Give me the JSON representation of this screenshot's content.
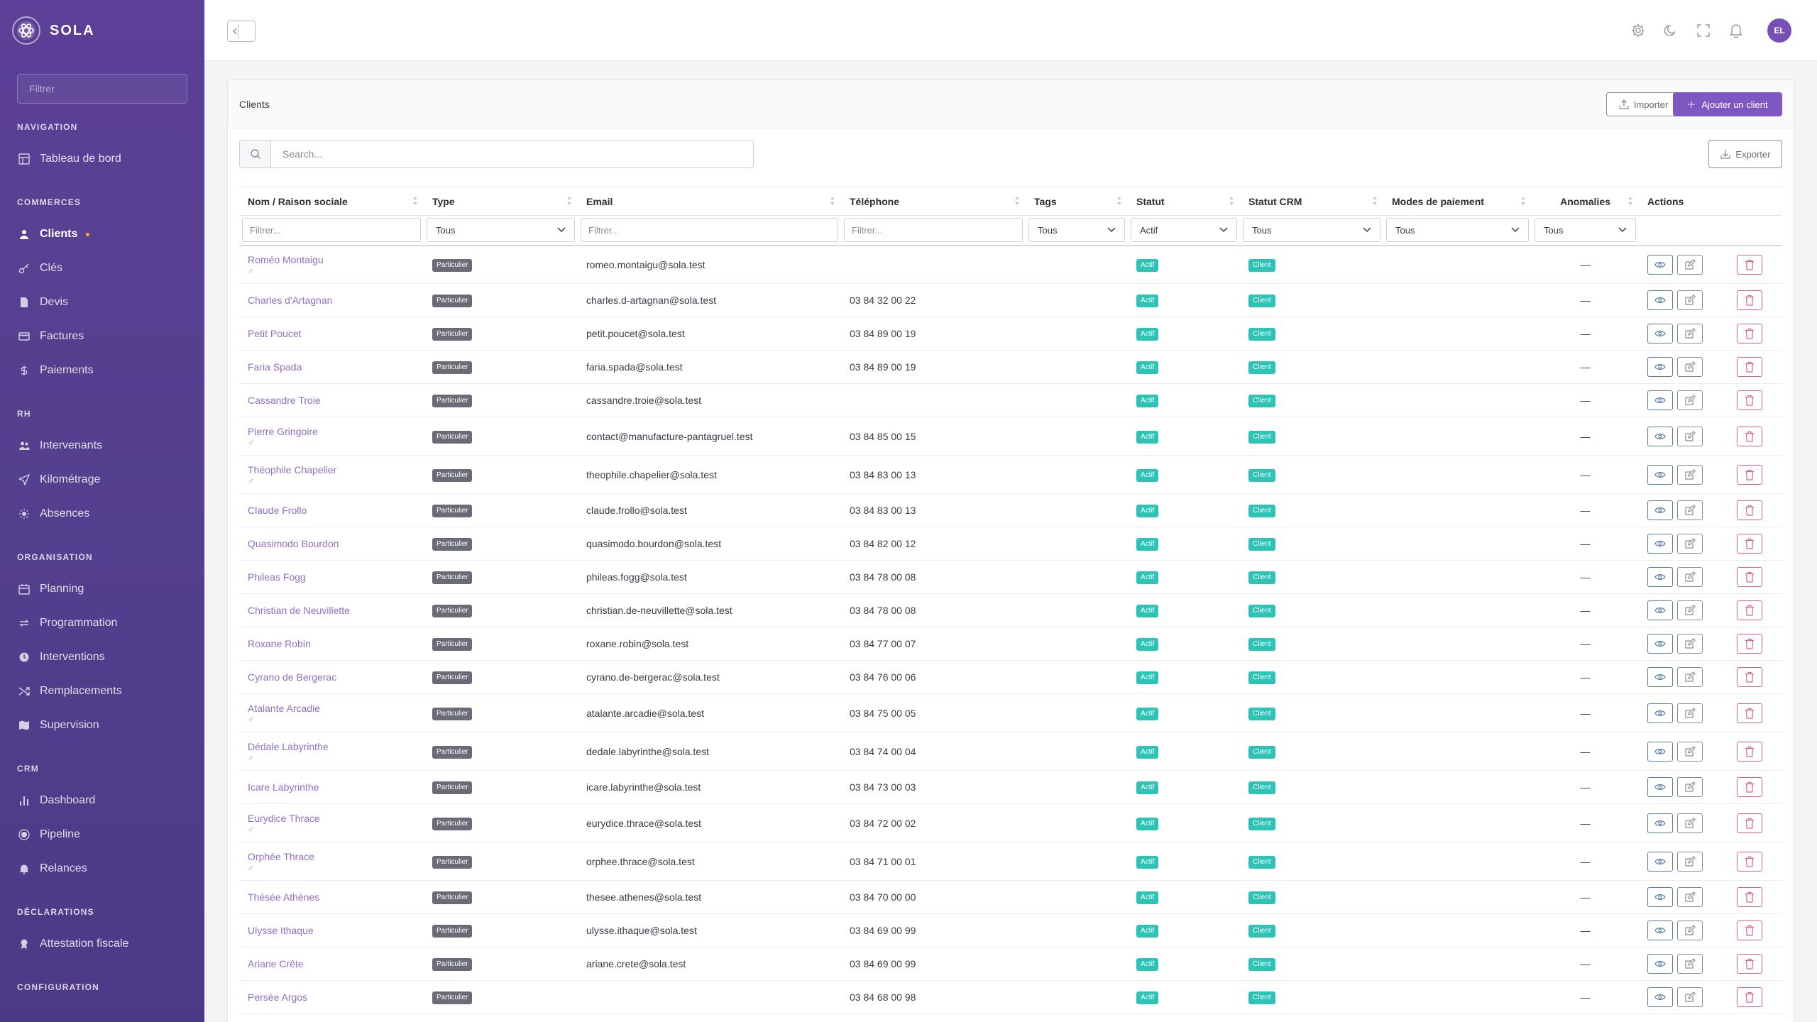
{
  "brand": {
    "name": "SOLA"
  },
  "sidebar": {
    "filter_placeholder": "Filtrer",
    "sections": [
      {
        "title": "NAVIGATION",
        "items": [
          {
            "label": "Tableau de bord",
            "icon": "dashboard-icon"
          }
        ]
      },
      {
        "title": "COMMERCES",
        "items": [
          {
            "label": "Clients",
            "icon": "users-icon",
            "active": true
          },
          {
            "label": "Clés",
            "icon": "key-icon"
          },
          {
            "label": "Devis",
            "icon": "document-icon"
          },
          {
            "label": "Factures",
            "icon": "card-icon"
          },
          {
            "label": "Paiements",
            "icon": "dollar-icon"
          }
        ]
      },
      {
        "title": "RH",
        "items": [
          {
            "label": "Intervenants",
            "icon": "people-icon"
          },
          {
            "label": "Kilométrage",
            "icon": "send-icon"
          },
          {
            "label": "Absences",
            "icon": "sun-icon"
          }
        ]
      },
      {
        "title": "ORGANISATION",
        "items": [
          {
            "label": "Planning",
            "icon": "calendar-icon"
          },
          {
            "label": "Programmation",
            "icon": "repeat-icon"
          },
          {
            "label": "Interventions",
            "icon": "clock-icon"
          },
          {
            "label": "Remplacements",
            "icon": "shuffle-icon"
          },
          {
            "label": "Supervision",
            "icon": "map-icon"
          }
        ]
      },
      {
        "title": "CRM",
        "items": [
          {
            "label": "Dashboard",
            "icon": "bar-chart-icon"
          },
          {
            "label": "Pipeline",
            "icon": "target-icon"
          },
          {
            "label": "Relances",
            "icon": "bell-icon"
          }
        ]
      },
      {
        "title": "DÉCLARATIONS",
        "items": [
          {
            "label": "Attestation fiscale",
            "icon": "award-icon"
          }
        ]
      },
      {
        "title": "CONFIGURATION",
        "items": []
      }
    ]
  },
  "topbar": {
    "avatar_initials": "EL"
  },
  "card": {
    "title": "Clients",
    "import_label": "Importer",
    "add_label": "Ajouter un client",
    "export_label": "Exporter",
    "search_placeholder": "Search..."
  },
  "table": {
    "columns": [
      "Nom / Raison sociale",
      "Type",
      "Email",
      "Téléphone",
      "Tags",
      "Statut",
      "Statut CRM",
      "Modes de paiement",
      "Anomalies",
      "Actions"
    ],
    "filters": {
      "name_placeholder": "Filtrer...",
      "type": "Tous",
      "email_placeholder": "Filtrer...",
      "phone_placeholder": "Filtrer...",
      "tags": "Tous",
      "statut": "Actif",
      "statut_crm": "Tous",
      "modes": "Tous",
      "anomalies": "Tous"
    },
    "rows": [
      {
        "name": "Roméo Montaigu",
        "gender": "♂",
        "type": "Particulier",
        "email": "romeo.montaigu@sola.test",
        "phone": "",
        "statut": "Actif",
        "crm": "Client",
        "anomalies": "—"
      },
      {
        "name": "Charles d'Artagnan",
        "gender": "",
        "type": "Particulier",
        "email": "charles.d-artagnan@sola.test",
        "phone": "03 84 32 00 22",
        "statut": "Actif",
        "crm": "Client",
        "anomalies": "—"
      },
      {
        "name": "Petit Poucet",
        "gender": "",
        "type": "Particulier",
        "email": "petit.poucet@sola.test",
        "phone": "03 84 89 00 19",
        "statut": "Actif",
        "crm": "Client",
        "anomalies": "—"
      },
      {
        "name": "Faria Spada",
        "gender": "",
        "type": "Particulier",
        "email": "faria.spada@sola.test",
        "phone": "03 84 89 00 19",
        "statut": "Actif",
        "crm": "Client",
        "anomalies": "—"
      },
      {
        "name": "Cassandre Troie",
        "gender": "",
        "type": "Particulier",
        "email": "cassandre.troie@sola.test",
        "phone": "",
        "statut": "Actif",
        "crm": "Client",
        "anomalies": "—"
      },
      {
        "name": "Pierre Gringoire",
        "gender": "♂",
        "type": "Particulier",
        "email": "contact@manufacture-pantagruel.test",
        "phone": "03 84 85 00 15",
        "statut": "Actif",
        "crm": "Client",
        "anomalies": "—"
      },
      {
        "name": "Théophile Chapelier",
        "gender": "♂",
        "type": "Particulier",
        "email": "theophile.chapelier@sola.test",
        "phone": "03 84 83 00 13",
        "statut": "Actif",
        "crm": "Client",
        "anomalies": "—"
      },
      {
        "name": "Claude Frollo",
        "gender": "",
        "type": "Particulier",
        "email": "claude.frollo@sola.test",
        "phone": "03 84 83 00 13",
        "statut": "Actif",
        "crm": "Client",
        "anomalies": "—"
      },
      {
        "name": "Quasimodo Bourdon",
        "gender": "",
        "type": "Particulier",
        "email": "quasimodo.bourdon@sola.test",
        "phone": "03 84 82 00 12",
        "statut": "Actif",
        "crm": "Client",
        "anomalies": "—"
      },
      {
        "name": "Phileas Fogg",
        "gender": "",
        "type": "Particulier",
        "email": "phileas.fogg@sola.test",
        "phone": "03 84 78 00 08",
        "statut": "Actif",
        "crm": "Client",
        "anomalies": "—"
      },
      {
        "name": "Christian de Neuvillette",
        "gender": "",
        "type": "Particulier",
        "email": "christian.de-neuvillette@sola.test",
        "phone": "03 84 78 00 08",
        "statut": "Actif",
        "crm": "Client",
        "anomalies": "—"
      },
      {
        "name": "Roxane Robin",
        "gender": "",
        "type": "Particulier",
        "email": "roxane.robin@sola.test",
        "phone": "03 84 77 00 07",
        "statut": "Actif",
        "crm": "Client",
        "anomalies": "—"
      },
      {
        "name": "Cyrano de Bergerac",
        "gender": "",
        "type": "Particulier",
        "email": "cyrano.de-bergerac@sola.test",
        "phone": "03 84 76 00 06",
        "statut": "Actif",
        "crm": "Client",
        "anomalies": "—"
      },
      {
        "name": "Atalante Arcadie",
        "gender": "♂",
        "type": "Particulier",
        "email": "atalante.arcadie@sola.test",
        "phone": "03 84 75 00 05",
        "statut": "Actif",
        "crm": "Client",
        "anomalies": "—"
      },
      {
        "name": "Dédale Labyrinthe",
        "gender": "♂",
        "type": "Particulier",
        "email": "dedale.labyrinthe@sola.test",
        "phone": "03 84 74 00 04",
        "statut": "Actif",
        "crm": "Client",
        "anomalies": "—"
      },
      {
        "name": "Icare Labyrinthe",
        "gender": "",
        "type": "Particulier",
        "email": "icare.labyrinthe@sola.test",
        "phone": "03 84 73 00 03",
        "statut": "Actif",
        "crm": "Client",
        "anomalies": "—"
      },
      {
        "name": "Eurydice Thrace",
        "gender": "♂",
        "type": "Particulier",
        "email": "eurydice.thrace@sola.test",
        "phone": "03 84 72 00 02",
        "statut": "Actif",
        "crm": "Client",
        "anomalies": "—"
      },
      {
        "name": "Orphée Thrace",
        "gender": "♂",
        "type": "Particulier",
        "email": "orphee.thrace@sola.test",
        "phone": "03 84 71 00 01",
        "statut": "Actif",
        "crm": "Client",
        "anomalies": "—"
      },
      {
        "name": "Thésée Athènes",
        "gender": "",
        "type": "Particulier",
        "email": "thesee.athenes@sola.test",
        "phone": "03 84 70 00 00",
        "statut": "Actif",
        "crm": "Client",
        "anomalies": "—"
      },
      {
        "name": "Ulysse Ithaque",
        "gender": "",
        "type": "Particulier",
        "email": "ulysse.ithaque@sola.test",
        "phone": "03 84 69 00 99",
        "statut": "Actif",
        "crm": "Client",
        "anomalies": "—"
      },
      {
        "name": "Ariane Crête",
        "gender": "",
        "type": "Particulier",
        "email": "ariane.crete@sola.test",
        "phone": "03 84 69 00 99",
        "statut": "Actif",
        "crm": "Client",
        "anomalies": "—"
      },
      {
        "name": "Persée Argos",
        "gender": "",
        "type": "Particulier",
        "email": "",
        "phone": "03 84 68 00 98",
        "statut": "Actif",
        "crm": "Client",
        "anomalies": "—"
      }
    ]
  },
  "colors": {
    "sidebar": "#54408f",
    "accent": "#7e57c2",
    "status_badge": "#2bc4b6",
    "type_badge": "#6b6b78",
    "link": "#8e6fc4"
  }
}
